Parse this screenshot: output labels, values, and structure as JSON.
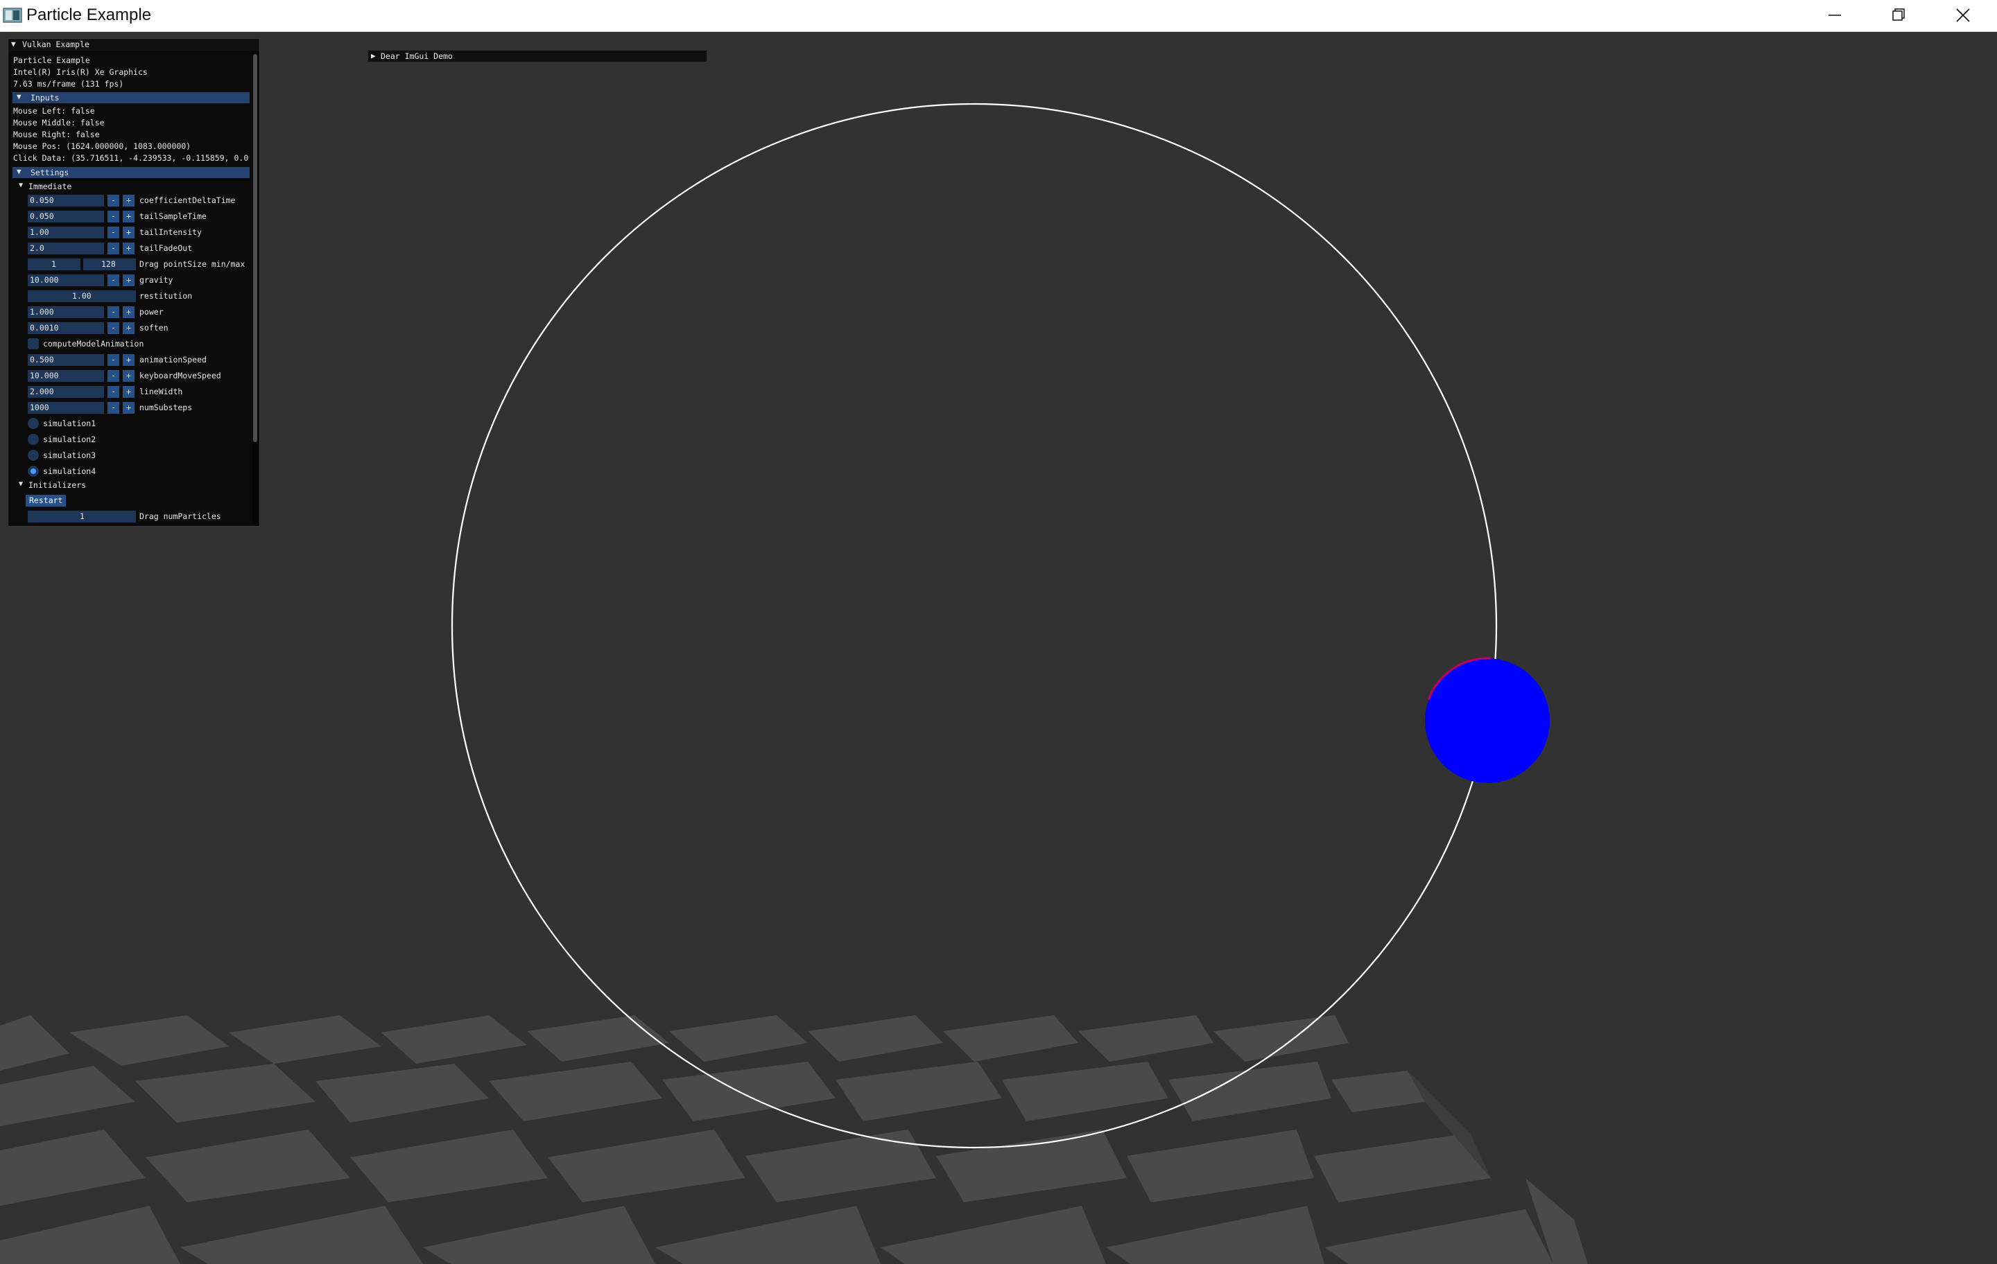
{
  "window": {
    "title": "Particle Example"
  },
  "titlebar_buttons": [
    "minimize-icon",
    "restore-icon",
    "close-icon"
  ],
  "demo_window": {
    "title": "Dear ImGui Demo"
  },
  "panel": {
    "title": "Vulkan Example",
    "app_name": "Particle Example",
    "device": "Intel(R) Iris(R) Xe Graphics",
    "frame_stats": "7.63 ms/frame (131 fps)",
    "inputs": {
      "header": "Inputs",
      "mouse_left": "Mouse Left: false",
      "mouse_middle": "Mouse Middle: false",
      "mouse_right": "Mouse Right: false",
      "mouse_pos": "Mouse Pos: (1624.000000, 1083.000000)",
      "click_data": "Click Data: (35.716511, -4.239533, -0.115859, 0.0"
    },
    "settings": {
      "header": "Settings",
      "immediate": "Immediate",
      "fields": {
        "coefficientDeltaTime": {
          "value": "0.050",
          "label": "coefficientDeltaTime"
        },
        "tailSampleTime": {
          "value": "0.050",
          "label": "tailSampleTime"
        },
        "tailIntensity": {
          "value": "1.00",
          "label": "tailIntensity"
        },
        "tailFadeOut": {
          "value": "2.0",
          "label": "tailFadeOut"
        },
        "pointSize": {
          "min": "1",
          "max": "128",
          "label": "Drag pointSize min/max"
        },
        "gravity": {
          "value": "10.000",
          "label": "gravity"
        },
        "restitution": {
          "value": "1.00",
          "label": "restitution"
        },
        "power": {
          "value": "1.000",
          "label": "power"
        },
        "soften": {
          "value": "0.0010",
          "label": "soften"
        },
        "computeModelAnimation": {
          "label": "computeModelAnimation",
          "checked": false
        },
        "animationSpeed": {
          "value": "0.500",
          "label": "animationSpeed"
        },
        "keyboardMoveSpeed": {
          "value": "10.000",
          "label": "keyboardMoveSpeed"
        },
        "lineWidth": {
          "value": "2.000",
          "label": "lineWidth"
        },
        "numSubsteps": {
          "value": "1000",
          "label": "numSubsteps"
        }
      },
      "simulations": [
        {
          "label": "simulation1",
          "selected": false
        },
        {
          "label": "simulation2",
          "selected": false
        },
        {
          "label": "simulation3",
          "selected": false
        },
        {
          "label": "simulation4",
          "selected": true
        }
      ],
      "stepper": {
        "minus": "-",
        "plus": "+"
      }
    },
    "initializers": {
      "header": "Initializers",
      "restart_label": "Restart",
      "numParticles": {
        "value": "1",
        "label": "Drag numParticles"
      }
    }
  },
  "colors": {
    "background": "#323232",
    "checker_dark": "#2e2e2e",
    "checker_light": "#4a4a4a",
    "ring": "#ffffff",
    "particle": "#0000ff",
    "particle_edge": "#c0005a",
    "imgui_header": "#24436e",
    "imgui_frame": "#1e3657",
    "imgui_button": "#26508a"
  }
}
